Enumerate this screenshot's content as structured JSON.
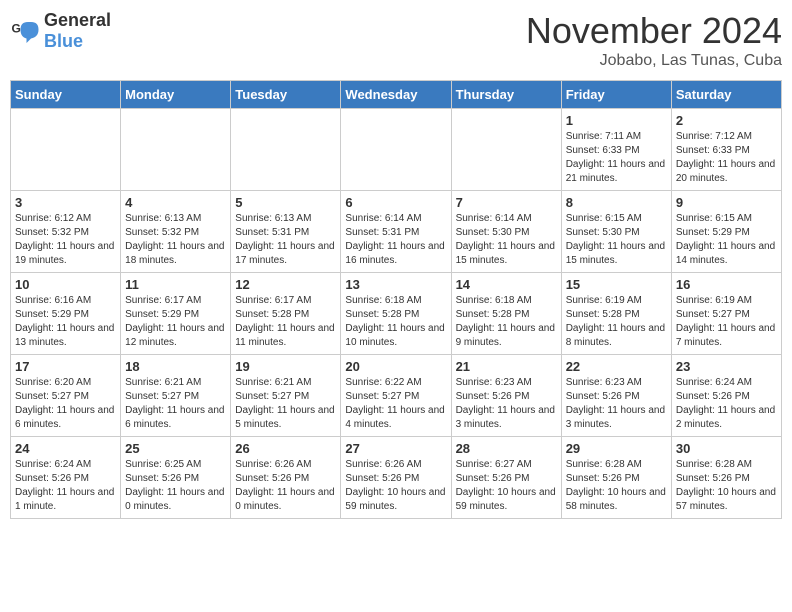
{
  "header": {
    "logo_general": "General",
    "logo_blue": "Blue",
    "month_title": "November 2024",
    "location": "Jobabo, Las Tunas, Cuba"
  },
  "weekdays": [
    "Sunday",
    "Monday",
    "Tuesday",
    "Wednesday",
    "Thursday",
    "Friday",
    "Saturday"
  ],
  "weeks": [
    [
      {
        "day": "",
        "info": ""
      },
      {
        "day": "",
        "info": ""
      },
      {
        "day": "",
        "info": ""
      },
      {
        "day": "",
        "info": ""
      },
      {
        "day": "",
        "info": ""
      },
      {
        "day": "1",
        "info": "Sunrise: 7:11 AM\nSunset: 6:33 PM\nDaylight: 11 hours and 21 minutes."
      },
      {
        "day": "2",
        "info": "Sunrise: 7:12 AM\nSunset: 6:33 PM\nDaylight: 11 hours and 20 minutes."
      }
    ],
    [
      {
        "day": "3",
        "info": "Sunrise: 6:12 AM\nSunset: 5:32 PM\nDaylight: 11 hours and 19 minutes."
      },
      {
        "day": "4",
        "info": "Sunrise: 6:13 AM\nSunset: 5:32 PM\nDaylight: 11 hours and 18 minutes."
      },
      {
        "day": "5",
        "info": "Sunrise: 6:13 AM\nSunset: 5:31 PM\nDaylight: 11 hours and 17 minutes."
      },
      {
        "day": "6",
        "info": "Sunrise: 6:14 AM\nSunset: 5:31 PM\nDaylight: 11 hours and 16 minutes."
      },
      {
        "day": "7",
        "info": "Sunrise: 6:14 AM\nSunset: 5:30 PM\nDaylight: 11 hours and 15 minutes."
      },
      {
        "day": "8",
        "info": "Sunrise: 6:15 AM\nSunset: 5:30 PM\nDaylight: 11 hours and 15 minutes."
      },
      {
        "day": "9",
        "info": "Sunrise: 6:15 AM\nSunset: 5:29 PM\nDaylight: 11 hours and 14 minutes."
      }
    ],
    [
      {
        "day": "10",
        "info": "Sunrise: 6:16 AM\nSunset: 5:29 PM\nDaylight: 11 hours and 13 minutes."
      },
      {
        "day": "11",
        "info": "Sunrise: 6:17 AM\nSunset: 5:29 PM\nDaylight: 11 hours and 12 minutes."
      },
      {
        "day": "12",
        "info": "Sunrise: 6:17 AM\nSunset: 5:28 PM\nDaylight: 11 hours and 11 minutes."
      },
      {
        "day": "13",
        "info": "Sunrise: 6:18 AM\nSunset: 5:28 PM\nDaylight: 11 hours and 10 minutes."
      },
      {
        "day": "14",
        "info": "Sunrise: 6:18 AM\nSunset: 5:28 PM\nDaylight: 11 hours and 9 minutes."
      },
      {
        "day": "15",
        "info": "Sunrise: 6:19 AM\nSunset: 5:28 PM\nDaylight: 11 hours and 8 minutes."
      },
      {
        "day": "16",
        "info": "Sunrise: 6:19 AM\nSunset: 5:27 PM\nDaylight: 11 hours and 7 minutes."
      }
    ],
    [
      {
        "day": "17",
        "info": "Sunrise: 6:20 AM\nSunset: 5:27 PM\nDaylight: 11 hours and 6 minutes."
      },
      {
        "day": "18",
        "info": "Sunrise: 6:21 AM\nSunset: 5:27 PM\nDaylight: 11 hours and 6 minutes."
      },
      {
        "day": "19",
        "info": "Sunrise: 6:21 AM\nSunset: 5:27 PM\nDaylight: 11 hours and 5 minutes."
      },
      {
        "day": "20",
        "info": "Sunrise: 6:22 AM\nSunset: 5:27 PM\nDaylight: 11 hours and 4 minutes."
      },
      {
        "day": "21",
        "info": "Sunrise: 6:23 AM\nSunset: 5:26 PM\nDaylight: 11 hours and 3 minutes."
      },
      {
        "day": "22",
        "info": "Sunrise: 6:23 AM\nSunset: 5:26 PM\nDaylight: 11 hours and 3 minutes."
      },
      {
        "day": "23",
        "info": "Sunrise: 6:24 AM\nSunset: 5:26 PM\nDaylight: 11 hours and 2 minutes."
      }
    ],
    [
      {
        "day": "24",
        "info": "Sunrise: 6:24 AM\nSunset: 5:26 PM\nDaylight: 11 hours and 1 minute."
      },
      {
        "day": "25",
        "info": "Sunrise: 6:25 AM\nSunset: 5:26 PM\nDaylight: 11 hours and 0 minutes."
      },
      {
        "day": "26",
        "info": "Sunrise: 6:26 AM\nSunset: 5:26 PM\nDaylight: 11 hours and 0 minutes."
      },
      {
        "day": "27",
        "info": "Sunrise: 6:26 AM\nSunset: 5:26 PM\nDaylight: 10 hours and 59 minutes."
      },
      {
        "day": "28",
        "info": "Sunrise: 6:27 AM\nSunset: 5:26 PM\nDaylight: 10 hours and 59 minutes."
      },
      {
        "day": "29",
        "info": "Sunrise: 6:28 AM\nSunset: 5:26 PM\nDaylight: 10 hours and 58 minutes."
      },
      {
        "day": "30",
        "info": "Sunrise: 6:28 AM\nSunset: 5:26 PM\nDaylight: 10 hours and 57 minutes."
      }
    ]
  ]
}
